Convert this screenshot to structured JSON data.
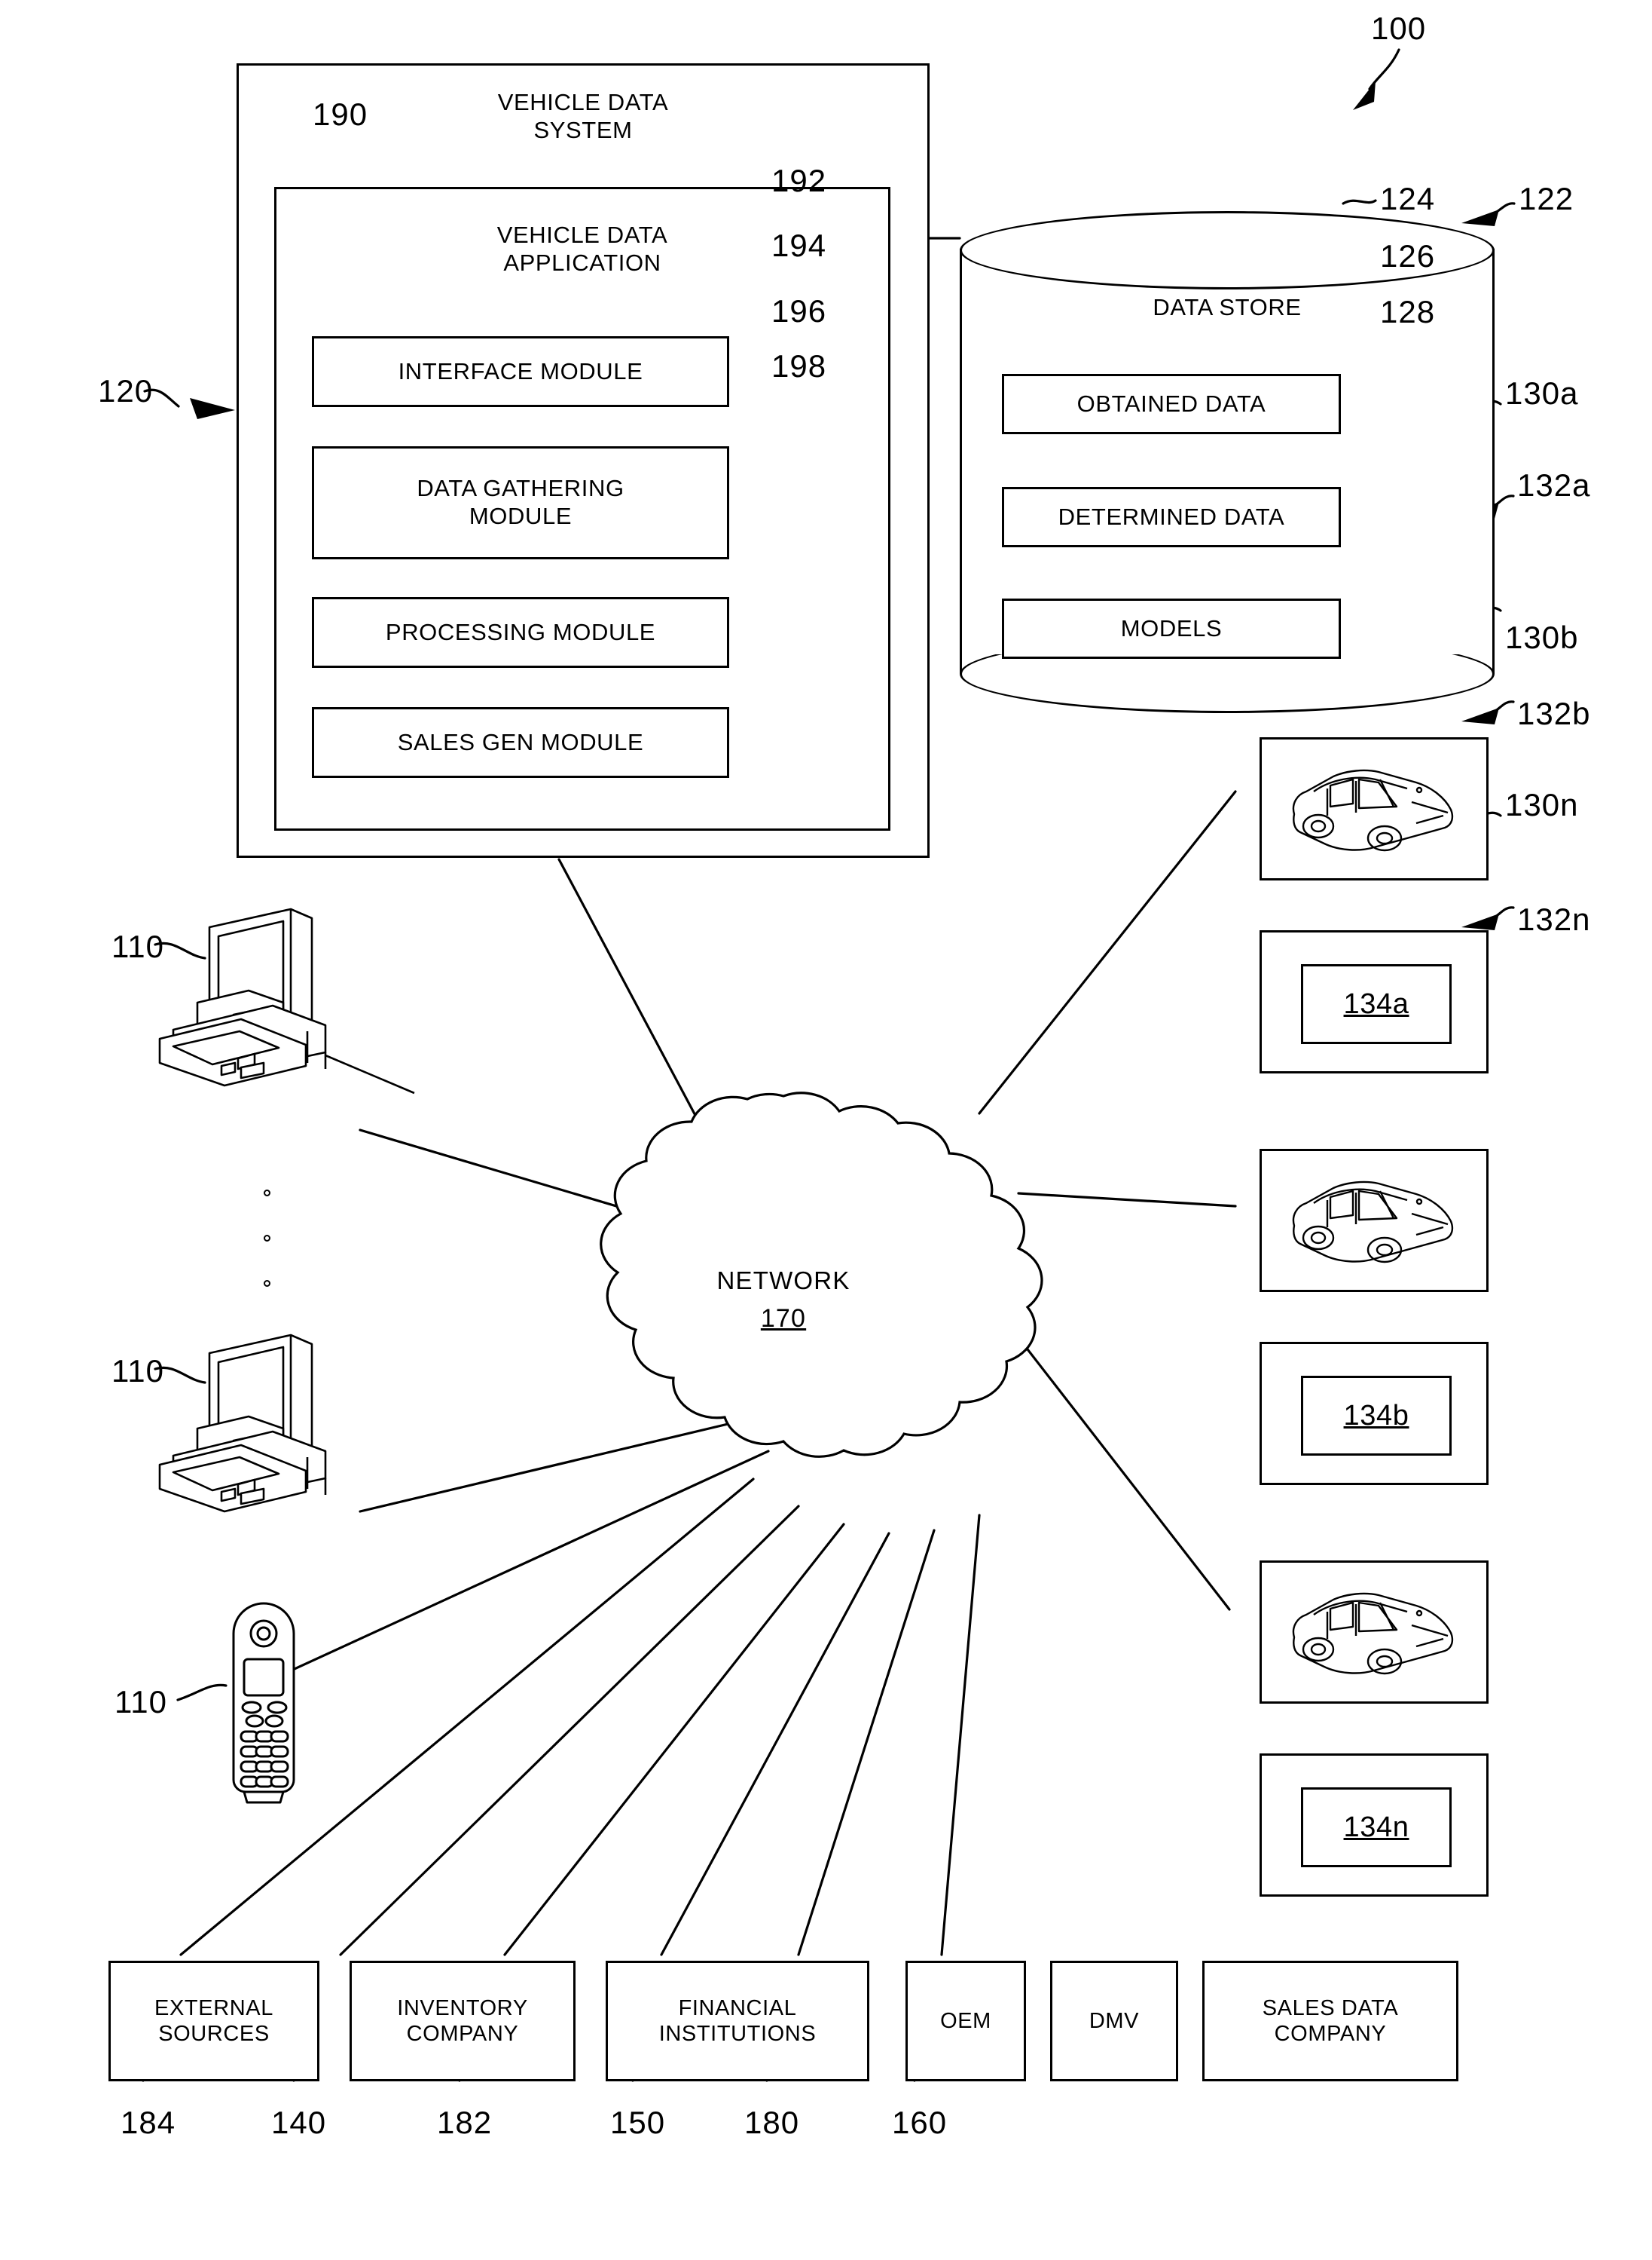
{
  "figure": {
    "overall_ref": "100"
  },
  "vehicle_data_system": {
    "ref": "120",
    "title": "VEHICLE DATA\nSYSTEM",
    "inner_ref": "190",
    "application": {
      "title": "VEHICLE DATA\nAPPLICATION",
      "modules": [
        {
          "label": "INTERFACE MODULE",
          "ref": "192"
        },
        {
          "label": "DATA GATHERING\nMODULE",
          "ref": "194"
        },
        {
          "label": "PROCESSING MODULE",
          "ref": "196"
        },
        {
          "label": "SALES GEN MODULE",
          "ref": "198"
        }
      ]
    }
  },
  "data_store": {
    "ref": "122",
    "title": "DATA STORE",
    "items": [
      {
        "label": "OBTAINED DATA",
        "ref": "124"
      },
      {
        "label": "DETERMINED DATA",
        "ref": "126"
      },
      {
        "label": "MODELS",
        "ref": "128"
      }
    ]
  },
  "network": {
    "title": "NETWORK",
    "ref": "170"
  },
  "clients": [
    {
      "type": "workstation",
      "ref": "110"
    },
    {
      "type": "workstation",
      "ref": "110"
    },
    {
      "type": "mobile-phone",
      "ref": "110"
    }
  ],
  "vehicles": [
    {
      "vehicle_ref": "130a",
      "display_ref": "132a",
      "screen_label": "134a"
    },
    {
      "vehicle_ref": "130b",
      "display_ref": "132b",
      "screen_label": "134b"
    },
    {
      "vehicle_ref": "130n",
      "display_ref": "132n",
      "screen_label": "134n"
    }
  ],
  "sources": [
    {
      "label": "EXTERNAL\nSOURCES",
      "ref": "184"
    },
    {
      "label": "INVENTORY\nCOMPANY",
      "ref": "140"
    },
    {
      "label": "FINANCIAL\nINSTITUTIONS",
      "ref": "182"
    },
    {
      "label": "OEM",
      "ref": "150"
    },
    {
      "label": "DMV",
      "ref": "180"
    },
    {
      "label": "SALES DATA\nCOMPANY",
      "ref": "160"
    }
  ],
  "colors": {
    "ink": "#000000",
    "paper": "#ffffff"
  }
}
